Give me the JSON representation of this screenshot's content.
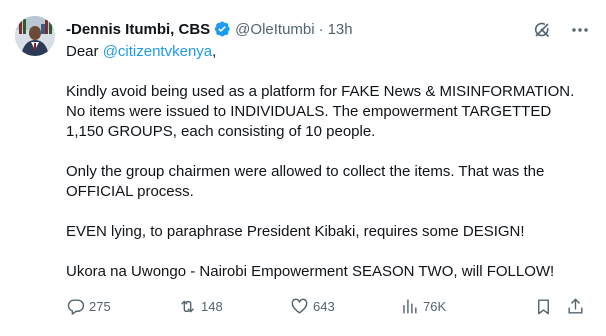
{
  "author": {
    "display_name": "-Dennis Itumbi, CBS",
    "handle": "@OleItumbi",
    "separator": "·",
    "time": "13h"
  },
  "tweet": {
    "greeting_prefix": "Dear ",
    "mention": "@citizentvkenya",
    "greeting_suffix": ",",
    "paragraph_1": "Kindly avoid being used as a platform for FAKE News & MISINFORMATION. No items were issued to INDIVIDUALS. The empowerment TARGETTED 1,150 GROUPS, each consisting of 10 people.",
    "paragraph_2": "Only the group chairmen were allowed to collect the items.  That was the OFFICIAL process.",
    "paragraph_3": "EVEN lying, to paraphrase President Kibaki, requires some DESIGN!",
    "paragraph_4": "Ukora na Uwongo - Nairobi Empowerment SEASON TWO, will FOLLOW!"
  },
  "actions": {
    "replies": "275",
    "retweets": "148",
    "likes": "643",
    "views": "76K"
  },
  "icons": {
    "verified": "verified-badge-icon",
    "grok": "grok-icon",
    "more": "more-icon",
    "reply": "reply-icon",
    "retweet": "retweet-icon",
    "like": "heart-icon",
    "views": "views-icon",
    "bookmark": "bookmark-icon",
    "share": "share-icon"
  },
  "colors": {
    "text": "#0f1419",
    "secondary": "#536471",
    "accent": "#1d9bf0"
  }
}
